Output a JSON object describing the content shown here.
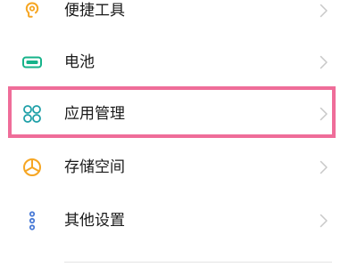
{
  "settings": {
    "items": [
      {
        "label": "便捷工具",
        "icon": "shortcut-tools-icon"
      },
      {
        "label": "电池",
        "icon": "battery-icon"
      },
      {
        "label": "应用管理",
        "icon": "app-management-icon",
        "highlighted": true
      },
      {
        "label": "存储空间",
        "icon": "storage-icon"
      },
      {
        "label": "其他设置",
        "icon": "other-settings-icon"
      }
    ]
  },
  "colors": {
    "accent_orange": "#f6a623",
    "accent_green": "#16b38a",
    "accent_teal": "#1fa0a8",
    "accent_blue": "#4a7bd6",
    "highlight_border": "#ef6d99",
    "chevron": "#c8c8c8"
  }
}
